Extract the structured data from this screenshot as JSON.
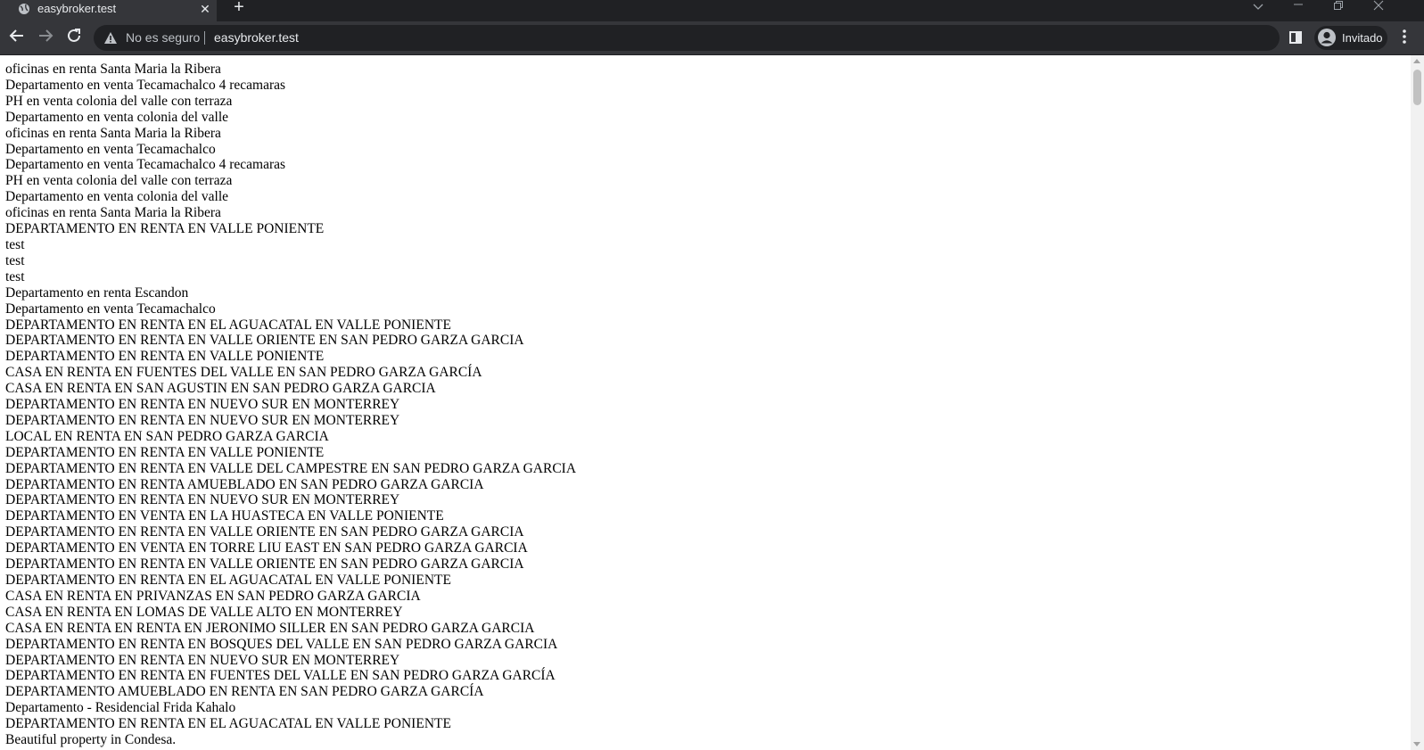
{
  "browser": {
    "tab": {
      "title": "easybroker.test",
      "favicon_icon": "globe-icon"
    },
    "new_tab_label": "+",
    "close_tab_label": "✕",
    "address_bar": {
      "security_text": "No es seguro",
      "url": "easybroker.test"
    },
    "profile_label": "Invitado",
    "icons": {
      "back": "arrow-left-icon",
      "forward": "arrow-right-icon",
      "reload": "reload-icon",
      "warning": "warning-triangle-icon",
      "side_panel": "side-panel-icon",
      "avatar": "person-icon",
      "menu": "kebab-menu-icon"
    },
    "colors": {
      "frame": "#202124",
      "toolbar": "#35363a",
      "text": "#e8eaed",
      "page_background": "#ffffff"
    }
  },
  "page": {
    "listings": [
      "oficinas en renta Santa Maria la Ribera",
      "Departamento en venta Tecamachalco 4 recamaras",
      "PH en venta colonia del valle con terraza",
      "Departamento en venta colonia del valle",
      "oficinas en renta Santa Maria la Ribera",
      "Departamento en venta Tecamachalco",
      "Departamento en venta Tecamachalco 4 recamaras",
      "PH en venta colonia del valle con terraza",
      "Departamento en venta colonia del valle",
      "oficinas en renta Santa Maria la Ribera",
      "DEPARTAMENTO EN RENTA EN VALLE PONIENTE",
      "test",
      "test",
      "test",
      "Departamento en renta Escandon",
      "Departamento en venta Tecamachalco",
      "DEPARTAMENTO EN RENTA EN EL AGUACATAL EN VALLE PONIENTE",
      "DEPARTAMENTO EN RENTA EN VALLE ORIENTE EN SAN PEDRO GARZA GARCIA",
      "DEPARTAMENTO EN RENTA EN VALLE PONIENTE",
      "CASA EN RENTA EN FUENTES DEL VALLE EN SAN PEDRO GARZA GARCÍA",
      "CASA EN RENTA EN SAN AGUSTIN EN SAN PEDRO GARZA GARCIA",
      "DEPARTAMENTO EN RENTA EN NUEVO SUR EN MONTERREY",
      "DEPARTAMENTO EN RENTA EN NUEVO SUR EN MONTERREY",
      "LOCAL EN RENTA EN SAN PEDRO GARZA GARCIA",
      "DEPARTAMENTO EN RENTA EN VALLE PONIENTE",
      "DEPARTAMENTO EN RENTA EN VALLE DEL CAMPESTRE EN SAN PEDRO GARZA GARCIA",
      "DEPARTAMENTO EN RENTA AMUEBLADO EN SAN PEDRO GARZA GARCIA",
      "DEPARTAMENTO EN RENTA EN NUEVO SUR EN MONTERREY",
      "DEPARTAMENTO EN VENTA EN LA HUASTECA EN VALLE PONIENTE",
      "DEPARTAMENTO EN RENTA EN VALLE ORIENTE EN SAN PEDRO GARZA GARCIA",
      "DEPARTAMENTO EN VENTA EN TORRE LIU EAST EN SAN PEDRO GARZA GARCIA",
      "DEPARTAMENTO EN RENTA EN VALLE ORIENTE EN SAN PEDRO GARZA GARCIA",
      "DEPARTAMENTO EN RENTA EN EL AGUACATAL EN VALLE PONIENTE",
      "CASA EN RENTA EN PRIVANZAS EN SAN PEDRO GARZA GARCIA",
      "CASA EN RENTA EN LOMAS DE VALLE ALTO EN MONTERREY",
      "CASA EN RENTA EN RENTA EN JERONIMO SILLER EN SAN PEDRO GARZA GARCIA",
      "DEPARTAMENTO EN RENTA EN BOSQUES DEL VALLE EN SAN PEDRO GARZA GARCIA",
      "DEPARTAMENTO EN RENTA EN NUEVO SUR EN MONTERREY",
      "DEPARTAMENTO EN RENTA EN FUENTES DEL VALLE EN SAN PEDRO GARZA GARCÍA",
      "DEPARTAMENTO AMUEBLADO EN RENTA EN SAN PEDRO GARZA GARCÍA",
      "Departamento - Residencial Frida Kahalo",
      "DEPARTAMENTO EN RENTA EN EL AGUACATAL EN VALLE PONIENTE",
      "Beautiful property in Condesa."
    ]
  }
}
